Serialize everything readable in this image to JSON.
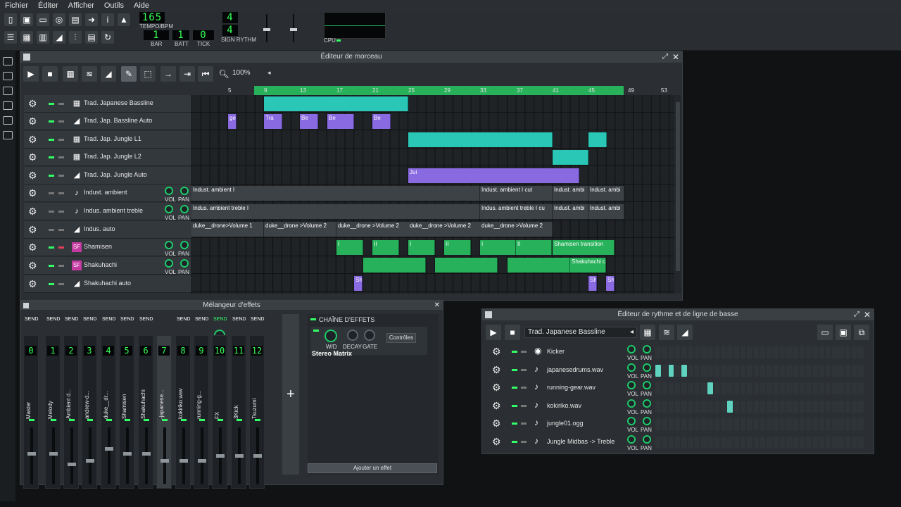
{
  "menu": [
    "Fichier",
    "Éditer",
    "Afficher",
    "Outils",
    "Aide"
  ],
  "transport": {
    "tempo_value": "165",
    "tempo_label": "TEMPO/BPM",
    "bar_label": "BAR",
    "batt_label": "BATT",
    "tick_label": "TICK",
    "bar_value": "1",
    "batt_value": "1",
    "tick_value": "0",
    "sig_top": "4",
    "sig_bottom": "4",
    "sig_label": "SIGN RYTHM",
    "cpu_label": "CPU"
  },
  "song_editor": {
    "title": "Éditeur de morceau",
    "zoom": "100%",
    "ruler": [
      "5",
      "9",
      "13",
      "17",
      "21",
      "25",
      "29",
      "33",
      "37",
      "41",
      "45",
      "49",
      "53"
    ],
    "tracks": [
      {
        "name": "Trad. Japanese Bassline",
        "type": "beat"
      },
      {
        "name": "Trad. Jap. Bassline Auto",
        "type": "auto"
      },
      {
        "name": "Trad. Jap. Jungle L1",
        "type": "beat"
      },
      {
        "name": "Trad. Jap. Jungle L2",
        "type": "beat"
      },
      {
        "name": "Trad. Jap. Jungle Auto",
        "type": "auto"
      },
      {
        "name": "Indust. ambient",
        "type": "sample"
      },
      {
        "name": "Indus. ambient treble",
        "type": "sample"
      },
      {
        "name": "Indus. auto",
        "type": "auto"
      },
      {
        "name": "Shamisen",
        "type": "instrument"
      },
      {
        "name": "Shakuhachi",
        "type": "instrument"
      },
      {
        "name": "Shakuhachi auto",
        "type": "auto"
      }
    ],
    "vol_label": "VOL",
    "pan_label": "PAN",
    "clip_labels": {
      "ge": "ge",
      "tra": "Tra",
      "be": "Be",
      "jun": "Jui",
      "amb1": "Indust. ambient I",
      "amb1cut": "Indust. ambient I cut",
      "amb_short": "Indust. ambi",
      "tre1": "Indus. ambient treble I",
      "tre1cut": "Indus. ambient treble I cu",
      "drone1": "duke__drone>Volume 1",
      "drone2": "duke__drone >Volume 2",
      "sham_trans": "Shamisen transition",
      "shak": "Shakuhachi c",
      "sh": "Sh",
      "roman1": "I",
      "roman2": "II"
    }
  },
  "mixer": {
    "title": "Mélangeur d'effets",
    "send_label": "SEND",
    "channels": [
      {
        "num": "0",
        "name": "Master"
      },
      {
        "num": "1",
        "name": "Melody"
      },
      {
        "num": "2",
        "name": "Ambient d..."
      },
      {
        "num": "3",
        "name": "andrew-d..."
      },
      {
        "num": "4",
        "name": "duke__dr..."
      },
      {
        "num": "5",
        "name": "Shamisen"
      },
      {
        "num": "6",
        "name": "Shakuhachi"
      },
      {
        "num": "7",
        "name": "-japanese..."
      },
      {
        "num": "8",
        "name": "kokiriko.wav"
      },
      {
        "num": "9",
        "name": "running-g..."
      },
      {
        "num": "10",
        "name": "FX"
      },
      {
        "num": "11",
        "name": "3Kick"
      },
      {
        "num": "12",
        "name": "Tsuzumi"
      }
    ],
    "add_label": "+",
    "chain_title": "CHAÎNE D'EFFETS",
    "wd_label": "W/D",
    "decay_label": "DECAY",
    "gate_label": "GATE",
    "controls_label": "Contrôles",
    "effect_name": "Stereo Matrix",
    "add_effect_label": "Ajouter un effet"
  },
  "beat_editor": {
    "title": "Éditeur de rythme et de ligne de basse",
    "selected_pattern": "Trad. Japanese Bassline",
    "vol_label": "VOL",
    "pan_label": "PAN",
    "rows": [
      {
        "name": "Kicker",
        "on": []
      },
      {
        "name": "japanesedrums.wav",
        "on": [
          0,
          2,
          4
        ]
      },
      {
        "name": "running-gear.wav",
        "on": [
          8
        ]
      },
      {
        "name": "kokiriko.wav",
        "on": [
          11
        ]
      },
      {
        "name": "jungle01.ogg",
        "on": []
      },
      {
        "name": "Jungle Midbas -> Treble",
        "on": []
      }
    ]
  },
  "colors": {
    "accent_green": "#33ff66",
    "pattern_teal": "#2ac7b6",
    "automation_purple": "#8a6ae0",
    "instrument_green": "#27b15a"
  }
}
